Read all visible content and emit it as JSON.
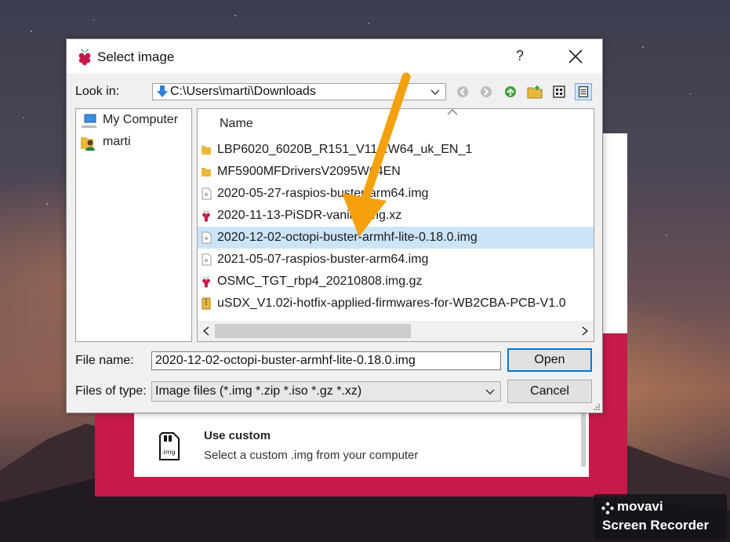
{
  "dialog": {
    "title": "Select image",
    "help_label": "?",
    "look_in_label": "Look in:",
    "look_in_path": "C:\\Users\\marti\\Downloads",
    "sidebar": [
      {
        "label": "My Computer",
        "icon": "computer-icon"
      },
      {
        "label": "marti",
        "icon": "user-folder-icon"
      }
    ],
    "list_header": "Name",
    "files": [
      {
        "name": "LBP6020_6020B_R151_V11...W64_uk_EN_1",
        "icon": "folder-icon"
      },
      {
        "name": "MF5900MFDriversV2095W64EN",
        "icon": "folder-icon"
      },
      {
        "name": "2020-05-27-raspios-buster-arm64.img",
        "icon": "disk-image-icon"
      },
      {
        "name": "2020-11-13-PiSDR-vanilla.img.xz",
        "icon": "raspberry-icon"
      },
      {
        "name": "2020-12-02-octopi-buster-armhf-lite-0.18.0.img",
        "icon": "disk-image-icon",
        "selected": true
      },
      {
        "name": "2021-05-07-raspios-buster-arm64.img",
        "icon": "disk-image-icon"
      },
      {
        "name": "OSMC_TGT_rbp4_20210808.img.gz",
        "icon": "raspberry-icon"
      },
      {
        "name": "uSDX_V1.02i-hotfix-applied-firmwares-for-WB2CBA-PCB-V1.0",
        "icon": "archive-icon"
      }
    ],
    "file_name_label": "File name:",
    "file_name_value": "2020-12-02-octopi-buster-armhf-lite-0.18.0.img",
    "files_of_type_label": "Files of type:",
    "files_of_type_value": "Image files (*.img *.zip *.iso *.gz *.xz)",
    "open_label": "Open",
    "cancel_label": "Cancel"
  },
  "background_app": {
    "custom_title": "Use custom",
    "custom_subtitle": "Select a custom .img from your computer",
    "sd_icon_text": ".img"
  },
  "watermark": {
    "brand": "movavi",
    "product": "Screen Recorder"
  },
  "colors": {
    "accent": "#0078d7",
    "selection": "#cce4f7",
    "crimson": "#c51a4a",
    "arrow": "#f5a10e"
  }
}
